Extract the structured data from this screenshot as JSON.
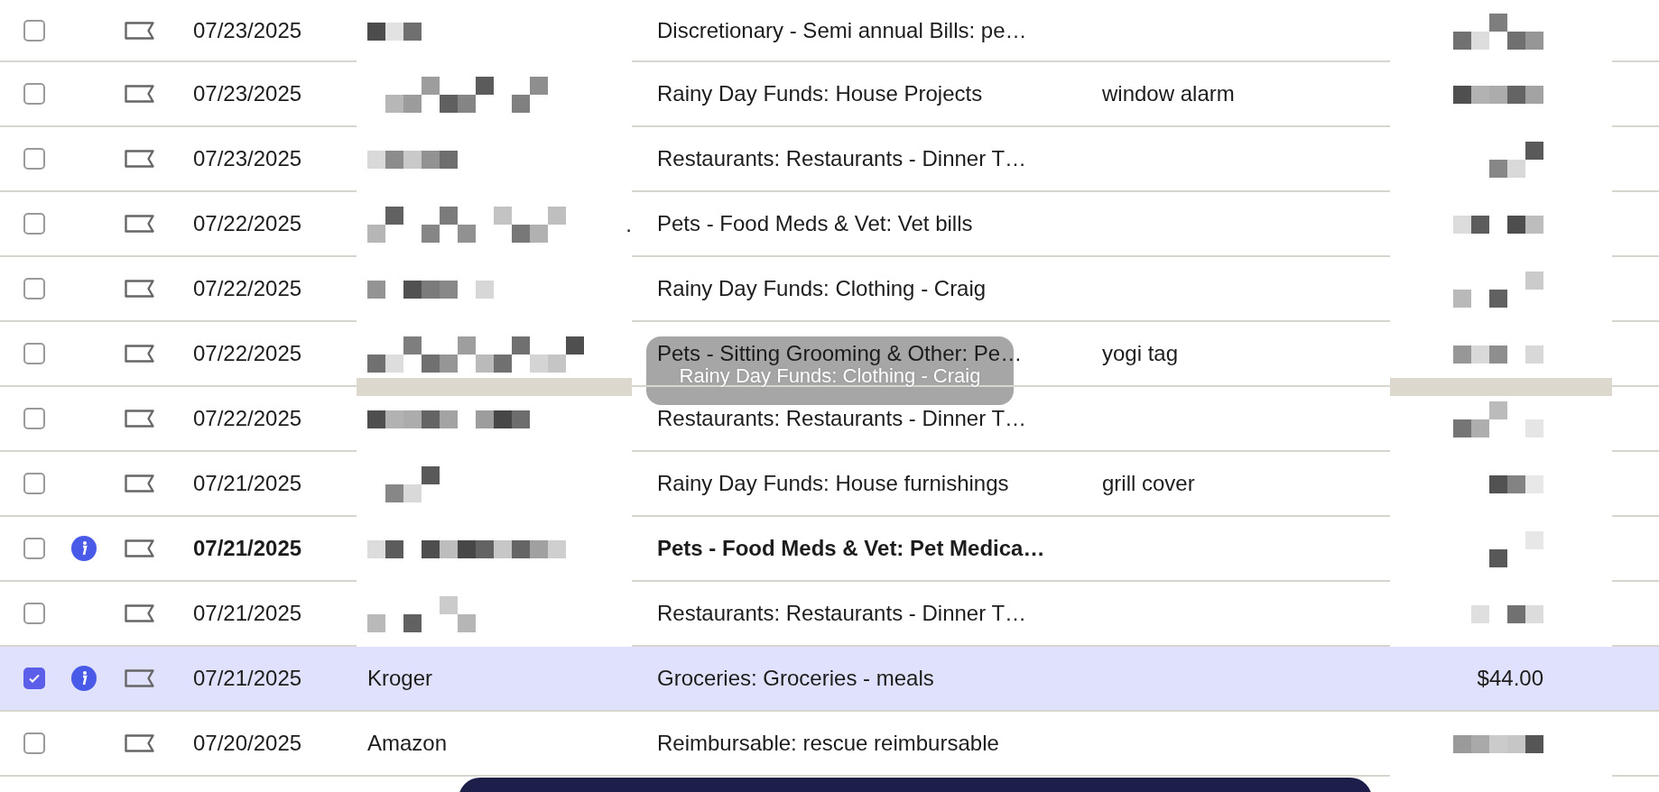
{
  "rows": [
    {
      "checked": false,
      "info": false,
      "bold": false,
      "date": "07/23/2025",
      "payee": {
        "kind": "redacted"
      },
      "category": "Discretionary - Semi annual Bills: pe…",
      "amount": {
        "kind": "redacted"
      },
      "drop_target": false
    },
    {
      "checked": false,
      "info": false,
      "bold": false,
      "date": "07/23/2025",
      "payee": {
        "kind": "redacted"
      },
      "category": "Rainy Day Funds: House Projects",
      "memo": "window alarm",
      "amount": {
        "kind": "redacted"
      },
      "drop_target": false
    },
    {
      "checked": false,
      "info": false,
      "bold": false,
      "date": "07/23/2025",
      "payee": {
        "kind": "redacted"
      },
      "category": "Restaurants: Restaurants - Dinner T…",
      "amount": {
        "kind": "redacted"
      },
      "drop_target": false
    },
    {
      "checked": false,
      "info": false,
      "bold": false,
      "date": "07/22/2025",
      "payee": {
        "kind": "redacted",
        "suffix": "."
      },
      "category": "Pets - Food Meds & Vet: Vet bills",
      "amount": {
        "kind": "redacted"
      },
      "drop_target": false
    },
    {
      "checked": false,
      "info": false,
      "bold": false,
      "date": "07/22/2025",
      "payee": {
        "kind": "redacted"
      },
      "category": "Rainy Day Funds: Clothing - Craig",
      "amount": {
        "kind": "redacted"
      },
      "drop_target": false
    },
    {
      "checked": false,
      "info": false,
      "bold": false,
      "date": "07/22/2025",
      "payee": {
        "kind": "redacted"
      },
      "category": "Pets - Sitting Grooming & Other: Pe…",
      "memo": "yogi tag",
      "amount": {
        "kind": "redacted"
      },
      "drop_target": true
    },
    {
      "checked": false,
      "info": false,
      "bold": false,
      "date": "07/22/2025",
      "payee": {
        "kind": "redacted"
      },
      "category": "Restaurants: Restaurants - Dinner T…",
      "amount": {
        "kind": "redacted"
      },
      "drop_target": false
    },
    {
      "checked": false,
      "info": false,
      "bold": false,
      "date": "07/21/2025",
      "payee": {
        "kind": "redacted"
      },
      "category": "Rainy Day Funds: House furnishings",
      "memo": "grill cover",
      "amount": {
        "kind": "redacted"
      },
      "drop_target": false
    },
    {
      "checked": false,
      "info": true,
      "bold": true,
      "date": "07/21/2025",
      "payee": {
        "kind": "redacted"
      },
      "category": "Pets - Food Meds & Vet: Pet Medica…",
      "amount": {
        "kind": "redacted"
      },
      "drop_target": false
    },
    {
      "checked": false,
      "info": false,
      "bold": false,
      "date": "07/21/2025",
      "payee": {
        "kind": "redacted"
      },
      "category": "Restaurants: Restaurants - Dinner T…",
      "amount": {
        "kind": "redacted"
      },
      "drop_target": false
    },
    {
      "checked": true,
      "info": true,
      "bold": false,
      "date": "07/21/2025",
      "payee": {
        "kind": "text",
        "text": "Kroger"
      },
      "category": "Groceries: Groceries - meals",
      "amount": {
        "kind": "text",
        "text": "$44.00"
      },
      "drop_target": false
    },
    {
      "checked": false,
      "info": false,
      "bold": false,
      "date": "07/20/2025",
      "payee": {
        "kind": "text",
        "text": "Amazon"
      },
      "category": "Reimbursable: rescue reimbursable",
      "amount": {
        "kind": "redacted"
      },
      "drop_target": false
    }
  ],
  "drag_ghost": {
    "label": "Rainy Day Funds: Clothing - Craig"
  }
}
